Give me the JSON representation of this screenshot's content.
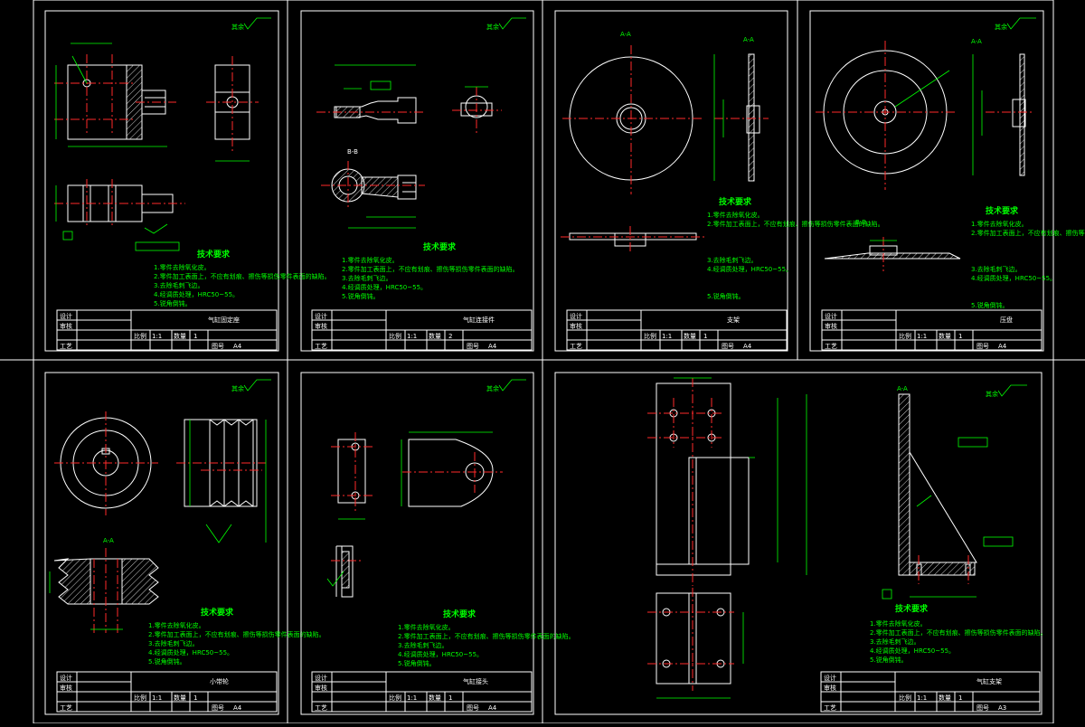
{
  "colors": {
    "background": "#000000",
    "outline": "#ffffff",
    "centerline": "#ff2a2a",
    "dimension": "#00ff00"
  },
  "symbols": {
    "roughness_other": "其余"
  },
  "sheets": [
    {
      "id": "s1",
      "heading": "技术要求",
      "title": "气缸固定座",
      "scale": "1:1",
      "qty": "1",
      "sheet": "A4"
    },
    {
      "id": "s2",
      "heading": "技术要求",
      "title": "气缸连接件",
      "scale": "1:1",
      "qty": "2",
      "sheet": "A4"
    },
    {
      "id": "s3",
      "heading": "技术要求",
      "title": "支架",
      "scale": "1:1",
      "qty": "1",
      "sheet": "A4"
    },
    {
      "id": "s4",
      "heading": "技术要求",
      "title": "压盘",
      "scale": "1:1",
      "qty": "1",
      "sheet": "A4"
    },
    {
      "id": "s5",
      "heading": "技术要求",
      "title": "小带轮",
      "scale": "1:1",
      "qty": "1",
      "sheet": "A4"
    },
    {
      "id": "s6",
      "heading": "技术要求",
      "title": "气缸接头",
      "scale": "1:1",
      "qty": "1",
      "sheet": "A4"
    },
    {
      "id": "s7",
      "heading": "技术要求",
      "title": "气缸支架",
      "scale": "1:1",
      "qty": "1",
      "sheet": "A3"
    }
  ],
  "title_block_labels": {
    "designer": "设计",
    "checker": "审核",
    "approver": "工艺",
    "scale": "比例",
    "qty": "数量",
    "sheet_size": "图号"
  },
  "section_labels": {
    "aa": "A-A",
    "bb": "B-B"
  },
  "notes": [
    "1.零件去除氧化皮。",
    "2.零件加工表面上，不应有划痕、擦伤等损伤零件表面的缺陷。",
    "3.去除毛刺飞边。",
    "4.经调质处理，HRC50~55。",
    "5.锐角倒钝。"
  ]
}
